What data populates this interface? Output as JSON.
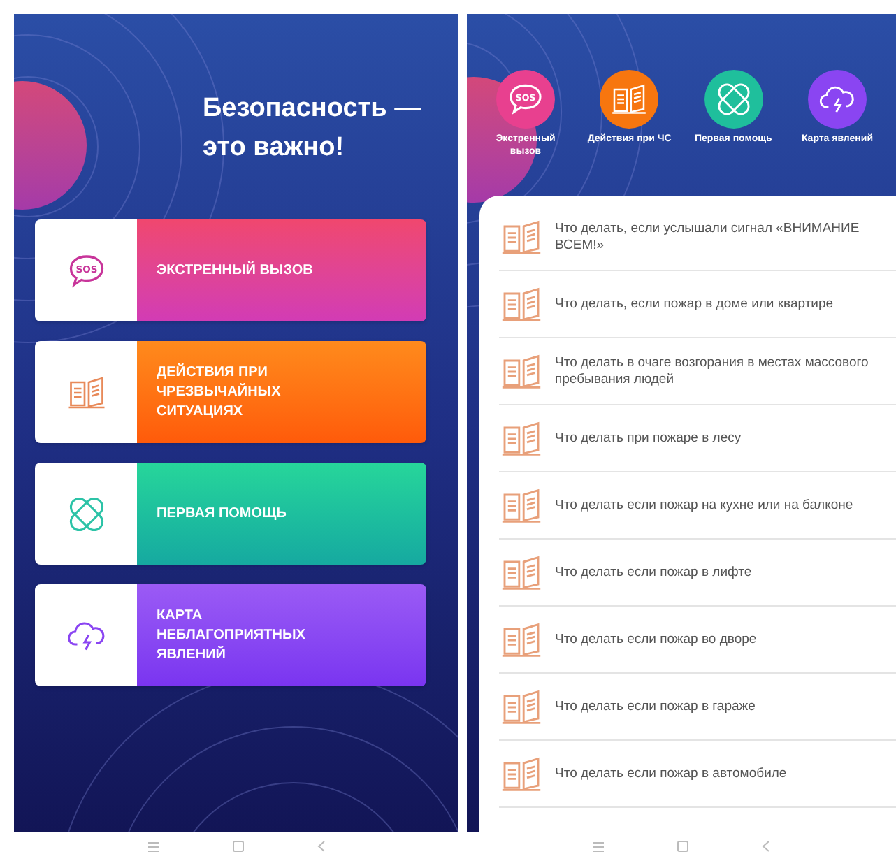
{
  "home": {
    "title": "Безопасность — это важно!",
    "menu": [
      {
        "kind": "sos",
        "badge": "SOS",
        "label": "ЭКСТРЕННЫЙ ВЫЗОВ"
      },
      {
        "kind": "book",
        "label": "ДЕЙСТВИЯ ПРИ ЧРЕЗВЫЧАЙНЫХ СИТУАЦИЯХ"
      },
      {
        "kind": "aid",
        "label": "ПЕРВАЯ ПОМОЩЬ"
      },
      {
        "kind": "weather",
        "label": "КАРТА НЕБЛАГОПРИЯТНЫХ ЯВЛЕНИЙ"
      }
    ]
  },
  "list_screen": {
    "shortcuts": [
      {
        "kind": "sos",
        "badge": "SOS",
        "label": "Экстренный вызов"
      },
      {
        "kind": "book",
        "label": "Действия при ЧС"
      },
      {
        "kind": "aid",
        "label": "Первая помощь"
      },
      {
        "kind": "weather",
        "label": "Карта явлений"
      }
    ],
    "articles": [
      "Что делать, если услышали сигнал «ВНИМАНИЕ ВСЕМ!»",
      "Что делать, если пожар в доме или квартире",
      "Что делать в очаге возгорания в местах массового пребывания людей",
      "Что делать при пожаре в лесу",
      "Что делать если пожар на кухне или на балконе",
      "Что делать если пожар в лифте",
      "Что делать если пожар во дворе",
      "Что делать если пожар в гараже",
      "Что делать если пожар в автомобиле"
    ]
  }
}
